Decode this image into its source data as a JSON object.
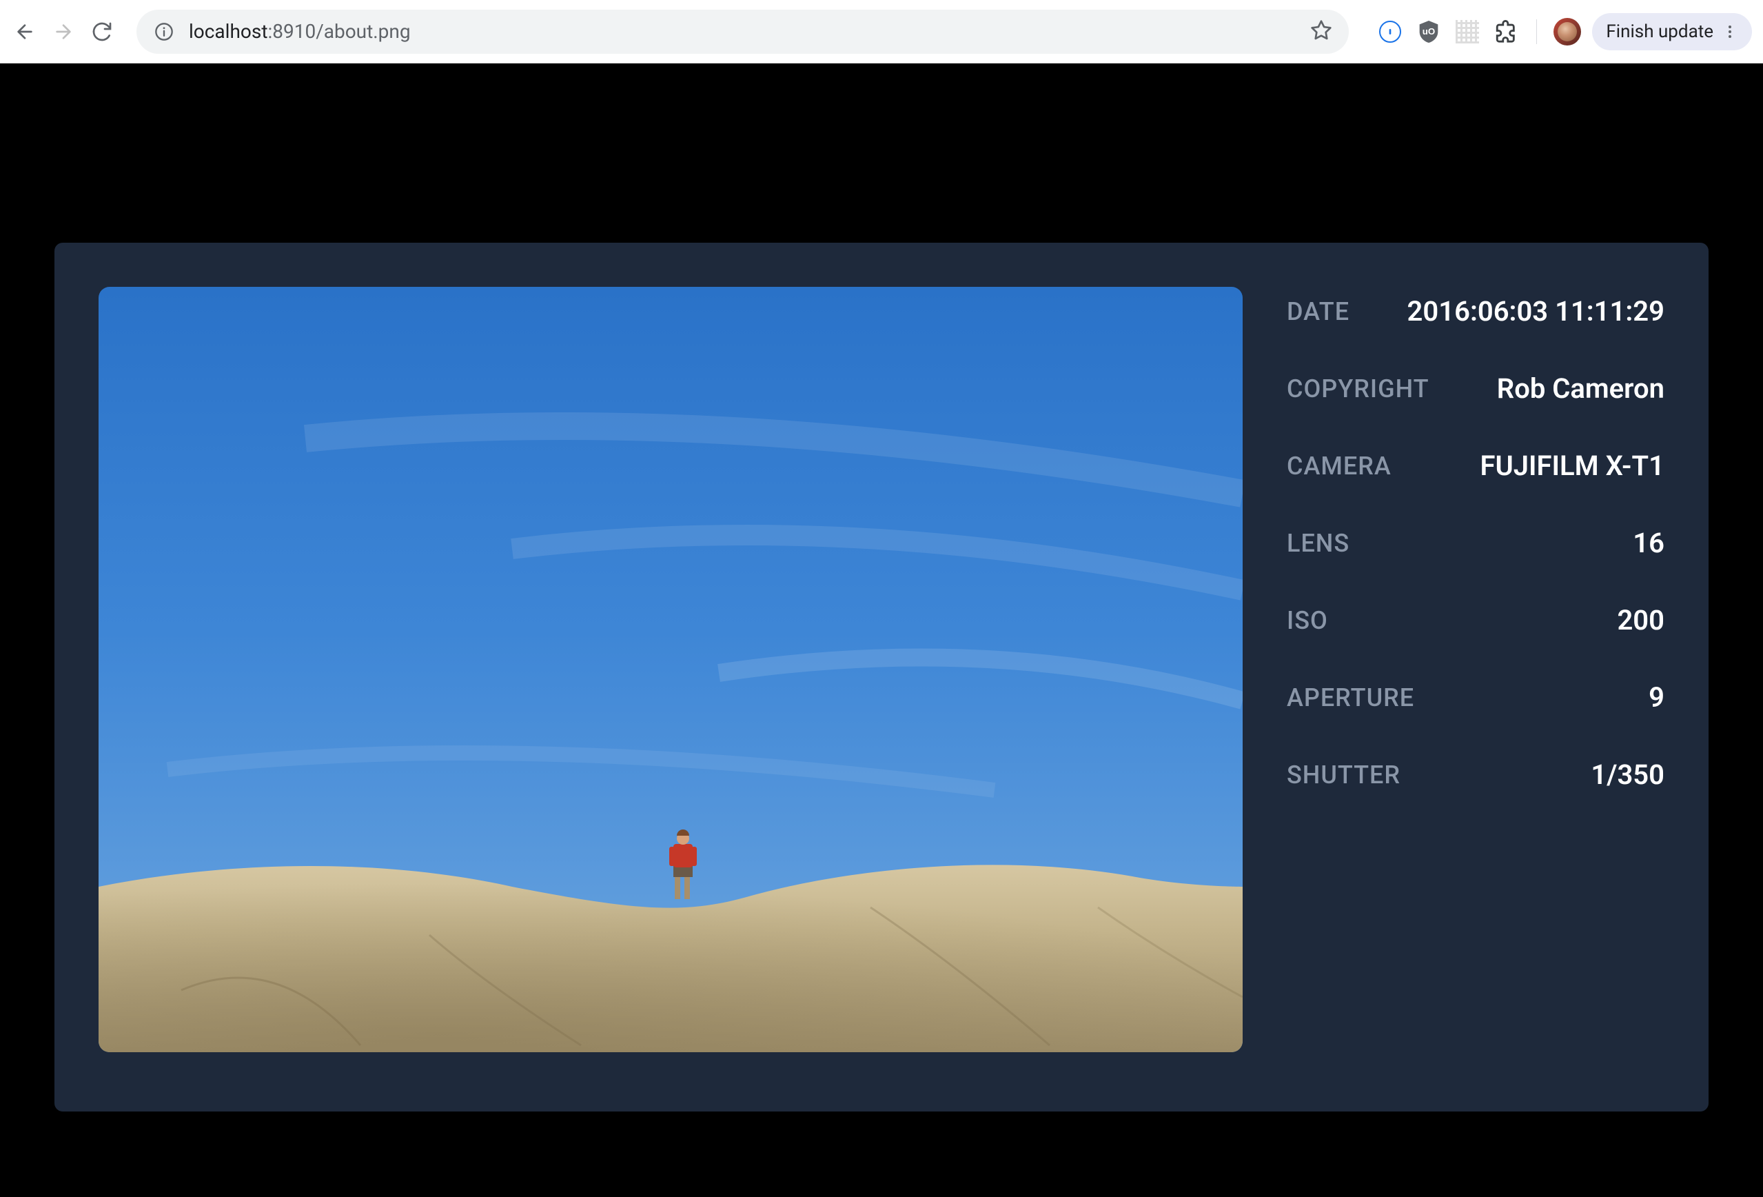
{
  "browser": {
    "url_host": "localhost",
    "url_path": ":8910/about.png",
    "finish_update_label": "Finish update"
  },
  "metadata": {
    "rows": [
      {
        "label": "DATE",
        "value": "2016:06:03 11:11:29"
      },
      {
        "label": "COPYRIGHT",
        "value": "Rob Cameron"
      },
      {
        "label": "CAMERA",
        "value": "FUJIFILM X-T1"
      },
      {
        "label": "LENS",
        "value": "16"
      },
      {
        "label": "ISO",
        "value": "200"
      },
      {
        "label": "APERTURE",
        "value": "9"
      },
      {
        "label": "SHUTTER",
        "value": "1/350"
      }
    ]
  }
}
